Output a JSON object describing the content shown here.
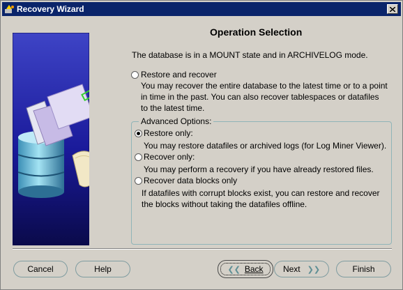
{
  "window": {
    "title": "Recovery Wizard",
    "icons": {
      "app": "wizard-icon",
      "close": "close-icon"
    }
  },
  "page": {
    "heading": "Operation Selection",
    "intro": "The database is in a MOUNT state and in ARCHIVELOG mode."
  },
  "options": {
    "restore_recover": {
      "label": "Restore and recover",
      "selected": false,
      "desc_lines": [
        "You may recover the entire database to the latest time or to a point",
        "in time in the past. You can also recover tablespaces or datafiles",
        "to the latest time."
      ]
    }
  },
  "advanced": {
    "label": "Advanced Options:",
    "restore_only": {
      "label": "Restore only:",
      "selected": true,
      "desc": "You may restore datafiles or archived logs (for Log Miner Viewer)."
    },
    "recover_only": {
      "label": "Recover only:",
      "selected": false,
      "desc": "You may perform a recovery if you have already restored files."
    },
    "recover_blocks": {
      "label": "Recover data blocks only",
      "selected": false,
      "desc_lines": [
        "If datafiles with corrupt blocks exist, you can restore and recover",
        "the blocks without taking the datafiles offline."
      ]
    }
  },
  "buttons": {
    "cancel": "Cancel",
    "help": "Help",
    "back": "Back",
    "next": "Next",
    "finish": "Finish"
  },
  "colors": {
    "titlebar": "#0a246a",
    "window_bg": "#d4d0c8",
    "accent_teal": "#8fb4b8"
  }
}
